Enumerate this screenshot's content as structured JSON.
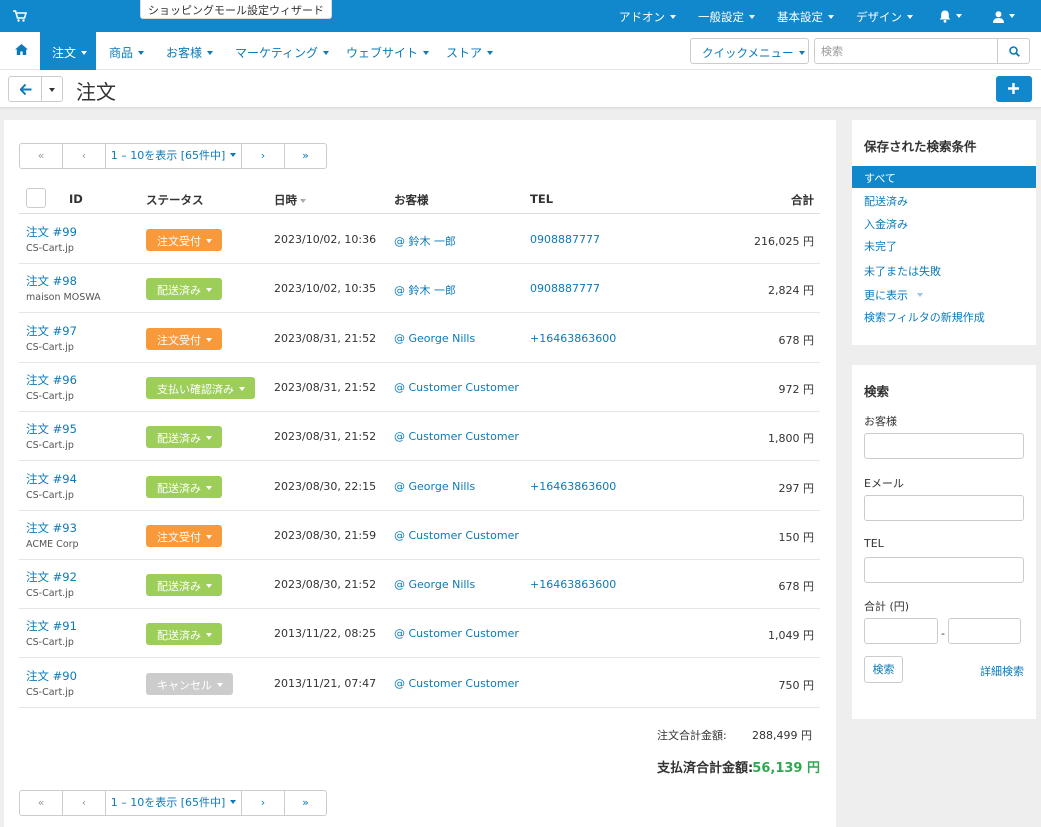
{
  "topbar": {
    "wizard_label": "ショッピングモール設定ウィザード",
    "menus": [
      "アドオン",
      "一般設定",
      "基本設定",
      "デザイン"
    ],
    "icons": [
      "bell-icon",
      "user-icon"
    ]
  },
  "nav": {
    "active": "注文",
    "items": [
      "商品",
      "お客様",
      "マーケティング",
      "ウェブサイト",
      "ストア"
    ],
    "quick_menu": "クイックメニュー",
    "search_placeholder": "検索"
  },
  "page": {
    "title": "注文"
  },
  "pager": {
    "first": "«",
    "prev": "‹",
    "info": "1 – 10を表示 [65件中]",
    "next": "›",
    "last": "»"
  },
  "table": {
    "headers": [
      "ID",
      "ステータス",
      "日時",
      "お客様",
      "TEL",
      "合計"
    ],
    "rows": [
      {
        "id": "注文 #99",
        "store": "CS-Cart.jp",
        "status": "注文受付",
        "status_color": "#f89a3c",
        "date": "2023/10/02, 10:36",
        "customer": "@ 鈴木 一郎",
        "tel": "0908887777",
        "total": "216,025 円"
      },
      {
        "id": "注文 #98",
        "store": "maison MOSWA",
        "status": "配送済み",
        "status_color": "#9dce5a",
        "date": "2023/10/02, 10:35",
        "customer": "@ 鈴木 一郎",
        "tel": "0908887777",
        "total": "2,824 円"
      },
      {
        "id": "注文 #97",
        "store": "CS-Cart.jp",
        "status": "注文受付",
        "status_color": "#f89a3c",
        "date": "2023/08/31, 21:52",
        "customer": "@ George Nills",
        "tel": "+16463863600",
        "total": "678 円"
      },
      {
        "id": "注文 #96",
        "store": "CS-Cart.jp",
        "status": "支払い確認済み",
        "status_color": "#9dce5a",
        "date": "2023/08/31, 21:52",
        "customer": "@ Customer Customer",
        "tel": "",
        "total": "972 円"
      },
      {
        "id": "注文 #95",
        "store": "CS-Cart.jp",
        "status": "配送済み",
        "status_color": "#9dce5a",
        "date": "2023/08/31, 21:52",
        "customer": "@ Customer Customer",
        "tel": "",
        "total": "1,800 円"
      },
      {
        "id": "注文 #94",
        "store": "CS-Cart.jp",
        "status": "配送済み",
        "status_color": "#9dce5a",
        "date": "2023/08/30, 22:15",
        "customer": "@ George Nills",
        "tel": "+16463863600",
        "total": "297 円"
      },
      {
        "id": "注文 #93",
        "store": "ACME Corp",
        "status": "注文受付",
        "status_color": "#f89a3c",
        "date": "2023/08/30, 21:59",
        "customer": "@ Customer Customer",
        "tel": "",
        "total": "150 円"
      },
      {
        "id": "注文 #92",
        "store": "CS-Cart.jp",
        "status": "配送済み",
        "status_color": "#9dce5a",
        "date": "2023/08/30, 21:52",
        "customer": "@ George Nills",
        "tel": "+16463863600",
        "total": "678 円"
      },
      {
        "id": "注文 #91",
        "store": "CS-Cart.jp",
        "status": "配送済み",
        "status_color": "#9dce5a",
        "date": "2013/11/22, 08:25",
        "customer": "@ Customer Customer",
        "tel": "",
        "total": "1,049 円"
      },
      {
        "id": "注文 #90",
        "store": "CS-Cart.jp",
        "status": "キャンセル",
        "status_color": "#cccccc",
        "date": "2013/11/21, 07:47",
        "customer": "@ Customer Customer",
        "tel": "",
        "total": "750 円"
      }
    ]
  },
  "summary": {
    "order_total_label": "注文合計金額:",
    "order_total_value": "288,499 円",
    "paid_total_label": "支払済合計金額:",
    "paid_total_value": "56,139 円"
  },
  "saved_filters": {
    "title": "保存された検索条件",
    "items": [
      "すべて",
      "配送済み",
      "入金済み",
      "未完了",
      "未了または失敗",
      "更に表示",
      "検索フィルタの新規作成"
    ],
    "active_index": 0
  },
  "search_panel": {
    "title": "検索",
    "customer_label": "お客様",
    "email_label": "Eメール",
    "tel_label": "TEL",
    "total_label": "合計 (円)",
    "range_sep": "-",
    "search_button": "検索",
    "advanced_link": "詳細検索"
  },
  "colors": {
    "primary": "#1188cc",
    "link": "#0b7ab8",
    "paid_total": "#2fa84f"
  }
}
